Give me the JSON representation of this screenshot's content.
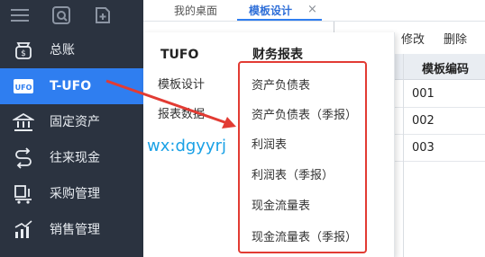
{
  "sidebar": {
    "top_icons": [
      "menu-icon",
      "search-doc-icon",
      "add-doc-icon"
    ],
    "items": [
      {
        "label": "总账",
        "icon": "ledger-bag-icon"
      },
      {
        "label": "T-UFO",
        "icon": "ufo-report-icon"
      },
      {
        "label": "固定资产",
        "icon": "bank-building-icon"
      },
      {
        "label": "往来现金",
        "icon": "exchange-arrows-icon"
      },
      {
        "label": "采购管理",
        "icon": "purchase-cart-icon"
      },
      {
        "label": "销售管理",
        "icon": "sales-chart-icon"
      }
    ]
  },
  "tabs": {
    "desktop": "我的桌面",
    "template_design": "模板设计",
    "close_glyph": "×"
  },
  "toolbar": {
    "modify": "修改",
    "delete": "删除"
  },
  "grid": {
    "header": "模板编码",
    "rows": [
      "001",
      "002",
      "003"
    ]
  },
  "menu": {
    "col1_title": "TUFO",
    "col1_items": [
      "模板设计",
      "报表数据"
    ],
    "col2_title": "财务报表",
    "col2_items": [
      "资产负债表",
      "资产负债表（季报）",
      "利润表",
      "利润表（季报）",
      "现金流量表",
      "现金流量表（季报）"
    ]
  },
  "watermark": "wx:dgyyrj",
  "colors": {
    "sidebar_bg": "#2b3340",
    "active_blue": "#2f7ef0",
    "annotation_red": "#e23b33",
    "watermark_blue": "#1aa1e6"
  }
}
